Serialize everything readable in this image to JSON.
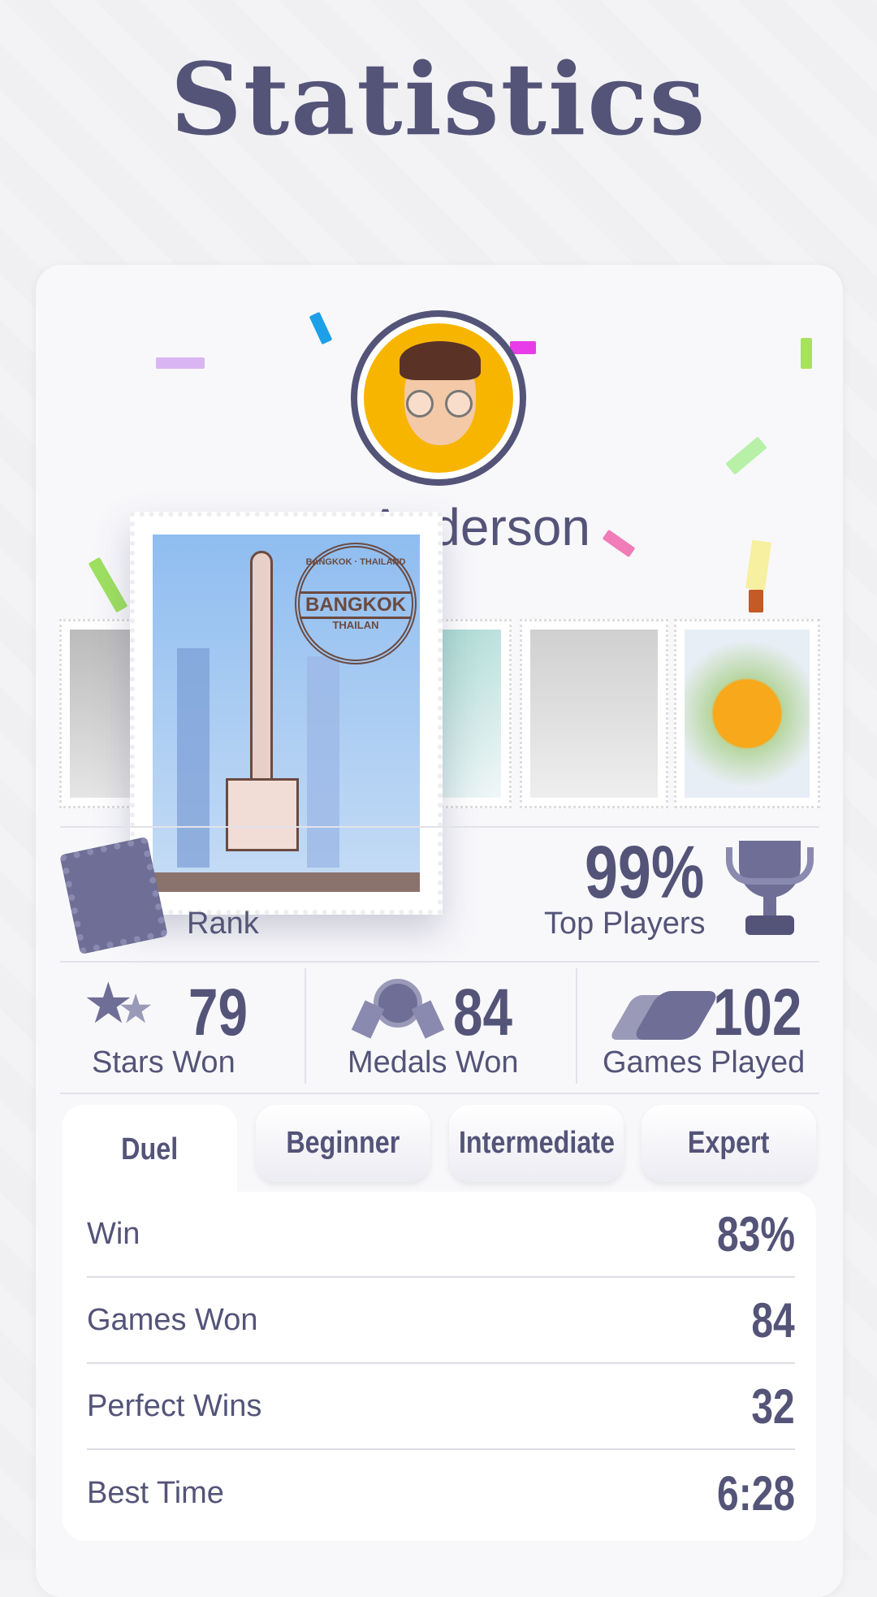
{
  "header": {
    "title": "Statistics"
  },
  "profile": {
    "name": "Anderson"
  },
  "featured_stamp": {
    "postmark_ring": "BANGKOK · THAILAND",
    "postmark_center": "BANGKOK",
    "postmark_sub": "THAILAN"
  },
  "rank": {
    "label": "Rank",
    "percent": "99%",
    "percent_label": "Top Players"
  },
  "summary": [
    {
      "value": "79",
      "label": "Stars Won",
      "icon": "stars-icon"
    },
    {
      "value": "84",
      "label": "Medals Won",
      "icon": "medal-icon"
    },
    {
      "value": "102",
      "label": "Games Played",
      "icon": "cards-icon"
    }
  ],
  "tabs": [
    {
      "label": "Duel",
      "active": true
    },
    {
      "label": "Beginner",
      "active": false
    },
    {
      "label": "Intermediate",
      "active": false
    },
    {
      "label": "Expert",
      "active": false
    }
  ],
  "stats": [
    {
      "label": "Win",
      "value": "83%"
    },
    {
      "label": "Games Won",
      "value": "84"
    },
    {
      "label": "Perfect Wins",
      "value": "32"
    },
    {
      "label": "Best Time",
      "value": "6:28"
    }
  ],
  "colors": {
    "primary": "#545479",
    "avatar_bg": "#F7B500",
    "card": "#F8F8FB"
  }
}
